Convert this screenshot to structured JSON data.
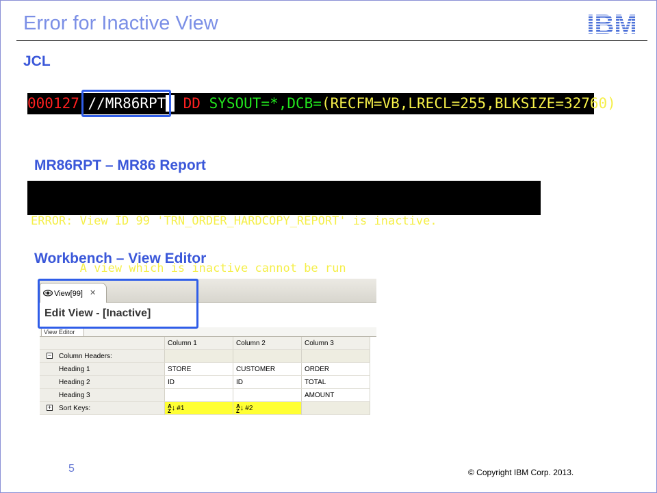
{
  "slide": {
    "title": "Error for Inactive View",
    "logo_text": "IBM",
    "page_number": "5",
    "copyright": "© Copyright  IBM Corp. 2013."
  },
  "sections": {
    "jcl": "JCL",
    "report": "MR86RPT – MR86 Report",
    "workbench": "Workbench – View Editor"
  },
  "jcl_line": {
    "line_number": "000127",
    "slashes": " //",
    "dd_name": "MR86RPT",
    "dd_keyword": "DD",
    "sysout": "SYSOUT=*,DCB=",
    "dcb_params": "(RECFM=VB,LRECL=255,BLKSIZE=32760)"
  },
  "report_lines": [
    "ERROR: View ID 99 'TRN_ORDER_HARDCOPY_REPORT' is inactive.",
    "       A view which is inactive cannot be run"
  ],
  "workbench": {
    "tab_label": "View[99]",
    "tab_close": "✕",
    "header_title": "Edit View - [Inactive]",
    "subtab_label": "View Editor",
    "columns": [
      "Column 1",
      "Column 2",
      "Column 3"
    ],
    "rows": {
      "column_headers": "Column Headers:",
      "heading1": "Heading 1",
      "heading2": "Heading 2",
      "heading3": "Heading 3",
      "sort_keys": "Sort Keys:"
    },
    "heading1_values": [
      "STORE",
      "CUSTOMER",
      "ORDER"
    ],
    "heading2_values": [
      "ID",
      "ID",
      "TOTAL"
    ],
    "heading3_values": [
      "",
      "",
      "AMOUNT"
    ],
    "sort_key_values": [
      "#1",
      "#2",
      ""
    ],
    "sort_icon_top": "A",
    "sort_icon_bottom": "Z"
  },
  "colors": {
    "title": "#7b8fe6",
    "section": "#3a57d9",
    "highlight_box": "#2f5de8",
    "terminal_yellow": "#f5ef4a",
    "terminal_green": "#22e61e",
    "terminal_red": "#ff2020"
  }
}
